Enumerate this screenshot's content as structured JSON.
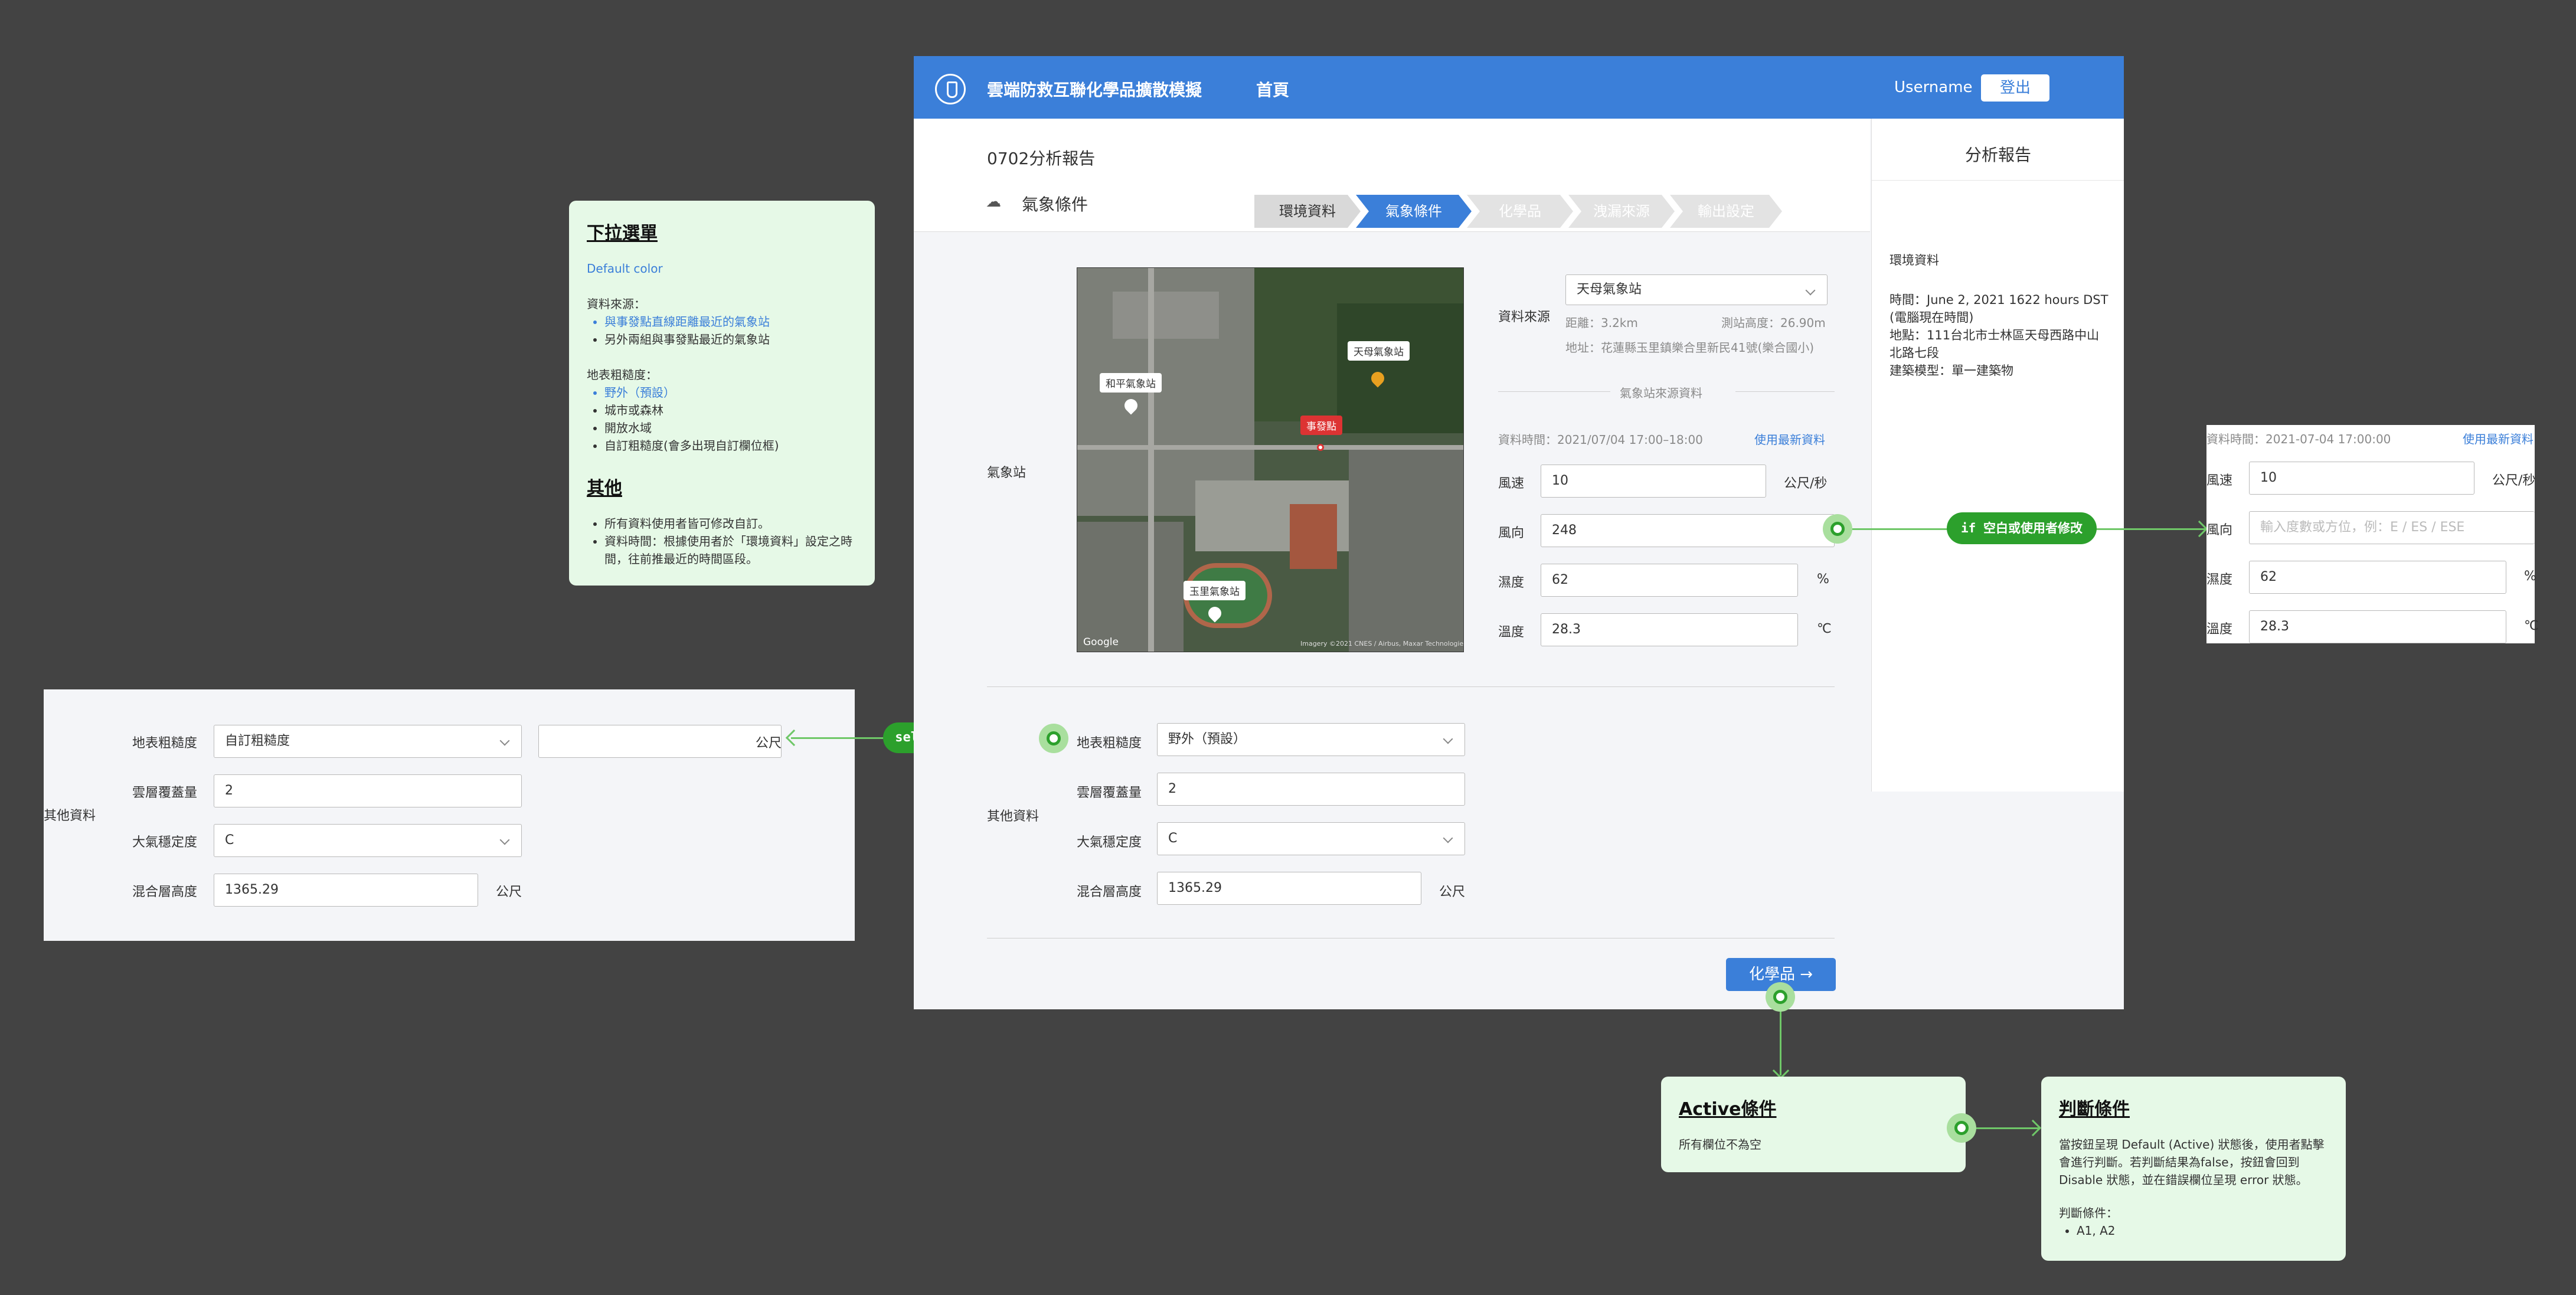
{
  "app": {
    "title": "雲端防救互聯化學品擴散模擬",
    "nav_home": "首頁",
    "username": "Username",
    "logout": "登出",
    "report_title": "0702分析報告",
    "section_title": "氣象條件",
    "steps": [
      "環境資料",
      "氣象條件",
      "化學品",
      "洩漏來源",
      "輸出設定"
    ],
    "active_step": 1
  },
  "station": {
    "label": "氣象站",
    "source_label": "資料來源",
    "source_value": "天母氣象站",
    "distance": "距離：3.2km",
    "height": "測站高度：26.90m",
    "address": "地址：花蓮縣玉里鎮樂合里新民41號(樂合國小)",
    "divider_text": "氣象站來源資料",
    "data_time": "資料時間：2021/07/04 17:00–18:00",
    "use_latest": "使用最新資料",
    "map_labels": {
      "tianmu": "天母氣象站",
      "heping": "和平氣象站",
      "incident": "事發點",
      "yuli": "玉里氣象站",
      "google": "Google",
      "credits": "Imagery ©2021 CNES / Airbus, Maxar Technologies"
    }
  },
  "weather_fields": [
    {
      "label": "風速",
      "value": "10",
      "unit": "公尺/秒"
    },
    {
      "label": "風向",
      "value": "248",
      "unit": ""
    },
    {
      "label": "濕度",
      "value": "62",
      "unit": "%"
    },
    {
      "label": "溫度",
      "value": "28.3",
      "unit": "℃"
    }
  ],
  "other": {
    "label": "其他資料",
    "roughness_label": "地表粗糙度",
    "roughness_value": "野外（預設）",
    "cloud_label": "雲層覆蓋量",
    "cloud_value": "2",
    "stability_label": "大氣穩定度",
    "stability_value": "C",
    "mixing_label": "混合層高度",
    "mixing_value": "1365.29",
    "mixing_unit": "公尺"
  },
  "next_button": "化學品 →",
  "report_panel": {
    "title": "分析報告",
    "sub": "環境資料",
    "lines": [
      "時間：June 2, 2021 1622 hours DST",
      "(電腦現在時間)",
      "地點：111台北市士林區天母西路中山",
      "北路七段",
      "建築模型：單一建築物"
    ]
  },
  "dropdown_card": {
    "title": "下拉選單",
    "default_color": "Default color",
    "source_heading": "資料來源：",
    "source_items": [
      "與事發點直線距離最近的氣象站",
      "另外兩組與事發點最近的氣象站"
    ],
    "roughness_heading": "地表粗糙度：",
    "roughness_items": [
      "野外（預設）",
      "城市或森林",
      "開放水域",
      "自訂粗糙度(會多出現自訂欄位框)"
    ],
    "other_title": "其他",
    "other_items": [
      "所有資料使用者皆可修改自訂。",
      "資料時間：根據使用者於「環境資料」設定之時間，往前推最近的時間區段。"
    ]
  },
  "variant_left": {
    "label": "其他資料",
    "roughness_label": "地表粗糙度",
    "roughness_value": "自訂粗糙度",
    "custom_value": "",
    "custom_unit": "公尺",
    "cloud_label": "雲層覆蓋量",
    "cloud_value": "2",
    "stability_label": "大氣穩定度",
    "stability_value": "C",
    "mixing_label": "混合層高度",
    "mixing_value": "1365.29",
    "mixing_unit": "公尺"
  },
  "variant_right": {
    "data_time": "資料時間：2021-07-04 17:00:00",
    "use_latest": "使用最新資料",
    "wind_speed_label": "風速",
    "wind_speed_value": "10",
    "wind_speed_unit": "公尺/秒",
    "wind_dir_label": "風向",
    "wind_dir_placeholder": "輸入度數或方位，例：E / ES / ESE",
    "humidity_label": "濕度",
    "humidity_value": "62",
    "humidity_unit": "%",
    "temp_label": "溫度",
    "temp_value": "28.3",
    "temp_unit": "℃"
  },
  "flow": {
    "select_pill": "select",
    "if_pill": "if 空白或使用者修改",
    "active_title": "Active條件",
    "active_text": "所有欄位不為空",
    "judge_title": "判斷條件",
    "judge_text": "當按鈕呈現 Default (Active) 狀態後，使用者點擊會進行判斷。若判斷結果為false，按鈕會回到 Disable 狀態，並在錯誤欄位呈現 error 狀態。",
    "judge_sub": "判斷條件：",
    "judge_items": [
      "A1, A2"
    ]
  },
  "colors": {
    "primary": "#3b7fd9",
    "background": "#434343",
    "annotation_green": "#2ca02c",
    "card_bg": "#e6f9e7"
  }
}
